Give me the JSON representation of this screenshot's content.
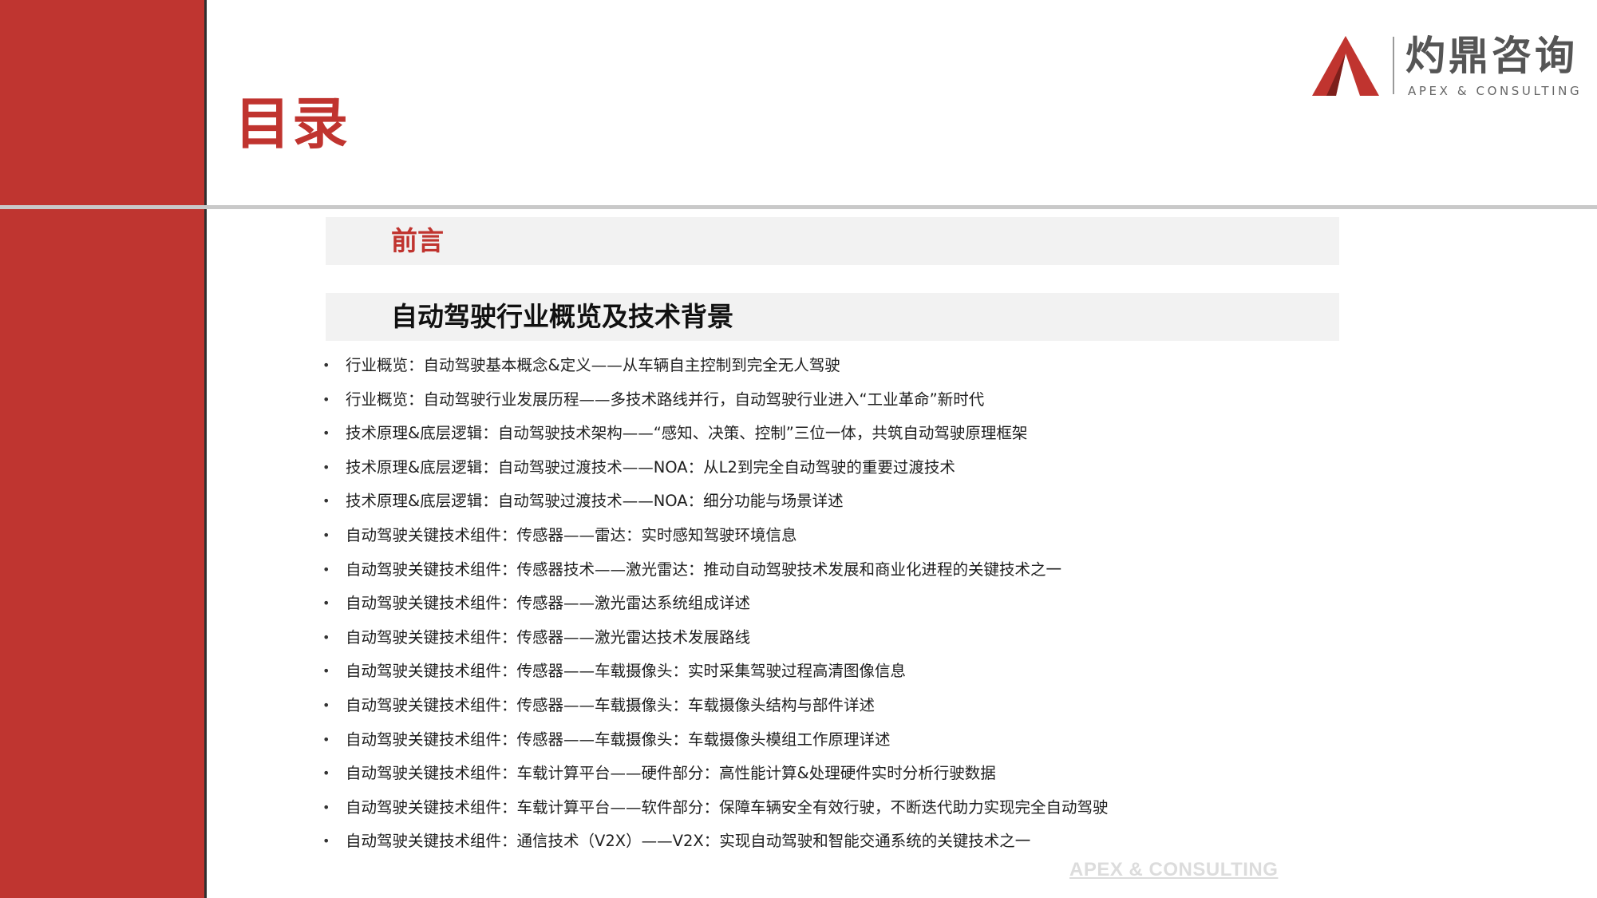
{
  "header": {
    "title": "目录"
  },
  "brand": {
    "name_cn": "灼鼎咨询",
    "name_en": "APEX & CONSULTING",
    "mark_color": "#c0342f"
  },
  "sections": [
    {
      "label": "前言"
    },
    {
      "label": "自动驾驶行业概览及技术背景"
    }
  ],
  "toc_items": [
    "行业概览：自动驾驶基本概念&定义——从车辆自主控制到完全无人驾驶",
    "行业概览：自动驾驶行业发展历程——多技术路线并行，自动驾驶行业进入“工业革命”新时代",
    "技术原理&底层逻辑：自动驾驶技术架构——“感知、决策、控制”三位一体，共筑自动驾驶原理框架",
    "技术原理&底层逻辑：自动驾驶过渡技术——NOA：从L2到完全自动驾驶的重要过渡技术",
    "技术原理&底层逻辑：自动驾驶过渡技术——NOA：细分功能与场景详述",
    "自动驾驶关键技术组件：传感器——雷达：实时感知驾驶环境信息",
    "自动驾驶关键技术组件：传感器技术——激光雷达：推动自动驾驶技术发展和商业化进程的关键技术之一",
    "自动驾驶关键技术组件：传感器——激光雷达系统组成详述",
    "自动驾驶关键技术组件：传感器——激光雷达技术发展路线",
    "自动驾驶关键技术组件：传感器——车载摄像头：实时采集驾驶过程高清图像信息",
    "自动驾驶关键技术组件：传感器——车载摄像头：车载摄像头结构与部件详述",
    "自动驾驶关键技术组件：传感器——车载摄像头：车载摄像头模组工作原理详述",
    "自动驾驶关键技术组件：车载计算平台——硬件部分：高性能计算&处理硬件实时分析行驶数据",
    "自动驾驶关键技术组件：车载计算平台——软件部分：保障车辆安全有效行驶，不断迭代助力实现完全自动驾驶",
    "自动驾驶关键技术组件：通信技术（V2X）——V2X：实现自动驾驶和智能交通系统的关键技术之一"
  ],
  "toc_bullet": "•",
  "watermark": "APEX & CONSULTING",
  "colors": {
    "accent": "#bf3530",
    "divider": "#2f2f2f",
    "rule": "#c9c9c9",
    "section_bg": "#f2f2f2"
  }
}
